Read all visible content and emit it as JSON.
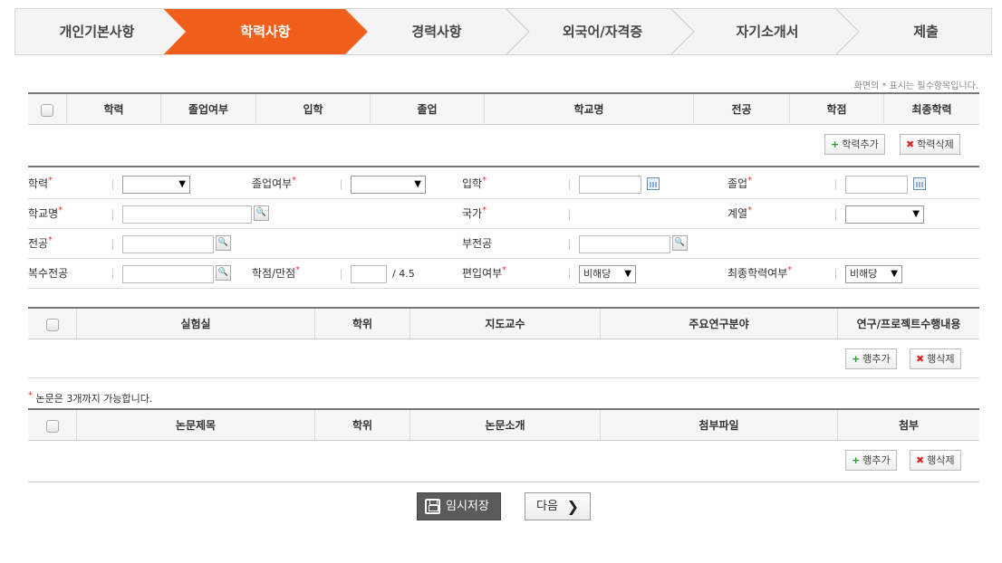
{
  "steps": [
    {
      "label": "개인기본사항"
    },
    {
      "label": "학력사항"
    },
    {
      "label": "경력사항"
    },
    {
      "label": "외국어/자격증"
    },
    {
      "label": "자기소개서"
    },
    {
      "label": "제출"
    }
  ],
  "required_note": "화면의 * 표시는 필수항목입니다.",
  "star": "*",
  "education_table": {
    "columns": [
      "학력",
      "졸업여부",
      "입학",
      "졸업",
      "학교명",
      "전공",
      "학점",
      "최종학력"
    ],
    "add_label": "학력추가",
    "delete_label": "학력삭제"
  },
  "form": {
    "degree_label": "학력",
    "graduation_label": "졸업여부",
    "admission_label": "입학",
    "grad_date_label": "졸업",
    "school_label": "학교명",
    "country_label": "국가",
    "field_label": "계열",
    "major_label": "전공",
    "minor_label": "부전공",
    "double_major_label": "복수전공",
    "gpa_label": "학점/만점",
    "gpa_max": "/ 4.5",
    "transfer_label": "편입여부",
    "transfer_value": "비해당",
    "final_edu_label": "최종학력여부",
    "final_edu_value": "비해당",
    "search_icon_glyph": "🔍",
    "dropdown_glyph": "▼"
  },
  "lab_table": {
    "columns": [
      "실험실",
      "학위",
      "지도교수",
      "주요연구분야",
      "연구/프로젝트수행내용"
    ],
    "add_label": "행추가",
    "delete_label": "행삭제"
  },
  "thesis_note": "논문은 3개까지 가능합니다.",
  "thesis_table": {
    "columns": [
      "논문제목",
      "학위",
      "논문소개",
      "첨부파일",
      "첨부"
    ],
    "add_label": "행추가",
    "delete_label": "행삭제"
  },
  "buttons": {
    "save_label": "임시저장",
    "next_label": "다음",
    "plus_glyph": "+",
    "x_glyph": "✖",
    "next_glyph": "❯"
  },
  "colors": {
    "active_step": "#f0601c",
    "required_star": "#ee3333"
  }
}
